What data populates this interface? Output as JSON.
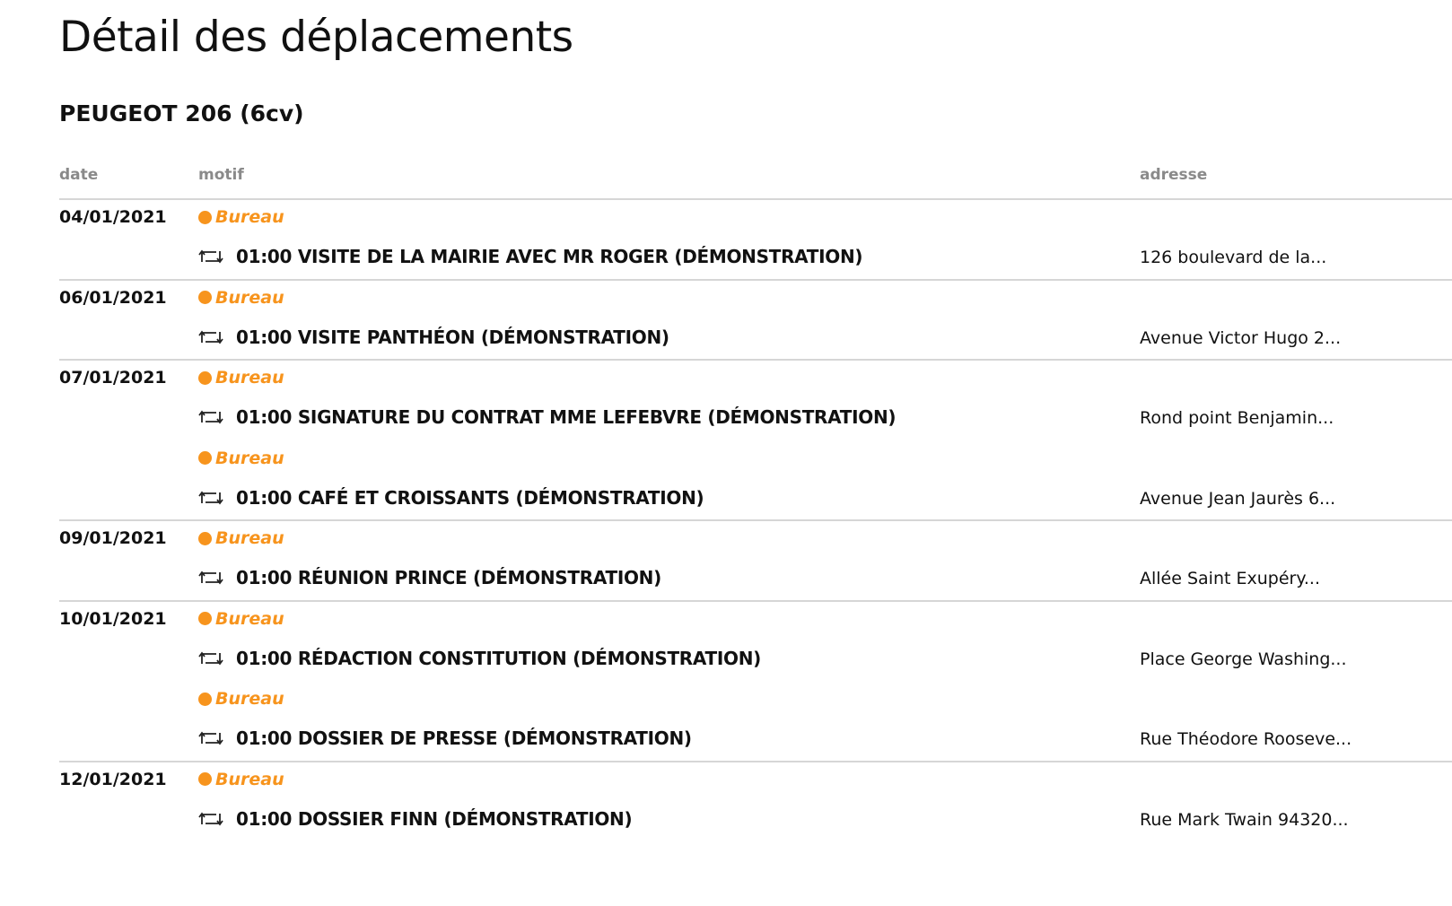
{
  "page": {
    "title": "Détail des déplacements",
    "vehicle": "PEUGEOT 206 (6cv)"
  },
  "columns": {
    "date": "date",
    "motif": "motif",
    "adresse": "adresse"
  },
  "colors": {
    "accent": "#f7941d",
    "text": "#111111",
    "header": "#8a8a8a",
    "separator": "#d6d6d6"
  },
  "icons": {
    "category": "orange-dot-icon",
    "trip": "repeat-icon"
  },
  "days": [
    {
      "date": "04/01/2021",
      "trips": [
        {
          "category": "Bureau",
          "text": "01:00 VISITE DE LA MAIRIE AVEC MR ROGER (DÉMONSTRATION)",
          "address": "126 boulevard de la..."
        }
      ]
    },
    {
      "date": "06/01/2021",
      "trips": [
        {
          "category": "Bureau",
          "text": "01:00 VISITE PANTHÉON (DÉMONSTRATION)",
          "address": "Avenue Victor Hugo 2..."
        }
      ]
    },
    {
      "date": "07/01/2021",
      "trips": [
        {
          "category": "Bureau",
          "text": "01:00 SIGNATURE DU CONTRAT MME LEFEBVRE (DÉMONSTRATION)",
          "address": "Rond point Benjamin..."
        },
        {
          "category": "Bureau",
          "text": "01:00 CAFÉ ET CROISSANTS (DÉMONSTRATION)",
          "address": "Avenue Jean Jaurès 6..."
        }
      ]
    },
    {
      "date": "09/01/2021",
      "trips": [
        {
          "category": "Bureau",
          "text": "01:00 RÉUNION PRINCE (DÉMONSTRATION)",
          "address": "Allée Saint Exupéry..."
        }
      ]
    },
    {
      "date": "10/01/2021",
      "trips": [
        {
          "category": "Bureau",
          "text": "01:00 RÉDACTION CONSTITUTION (DÉMONSTRATION)",
          "address": "Place George Washing..."
        },
        {
          "category": "Bureau",
          "text": "01:00 DOSSIER DE PRESSE (DÉMONSTRATION)",
          "address": "Rue Théodore Rooseve..."
        }
      ]
    },
    {
      "date": "12/01/2021",
      "trips": [
        {
          "category": "Bureau",
          "text": "01:00 DOSSIER FINN (DÉMONSTRATION)",
          "address": "Rue Mark Twain 94320..."
        }
      ]
    }
  ]
}
